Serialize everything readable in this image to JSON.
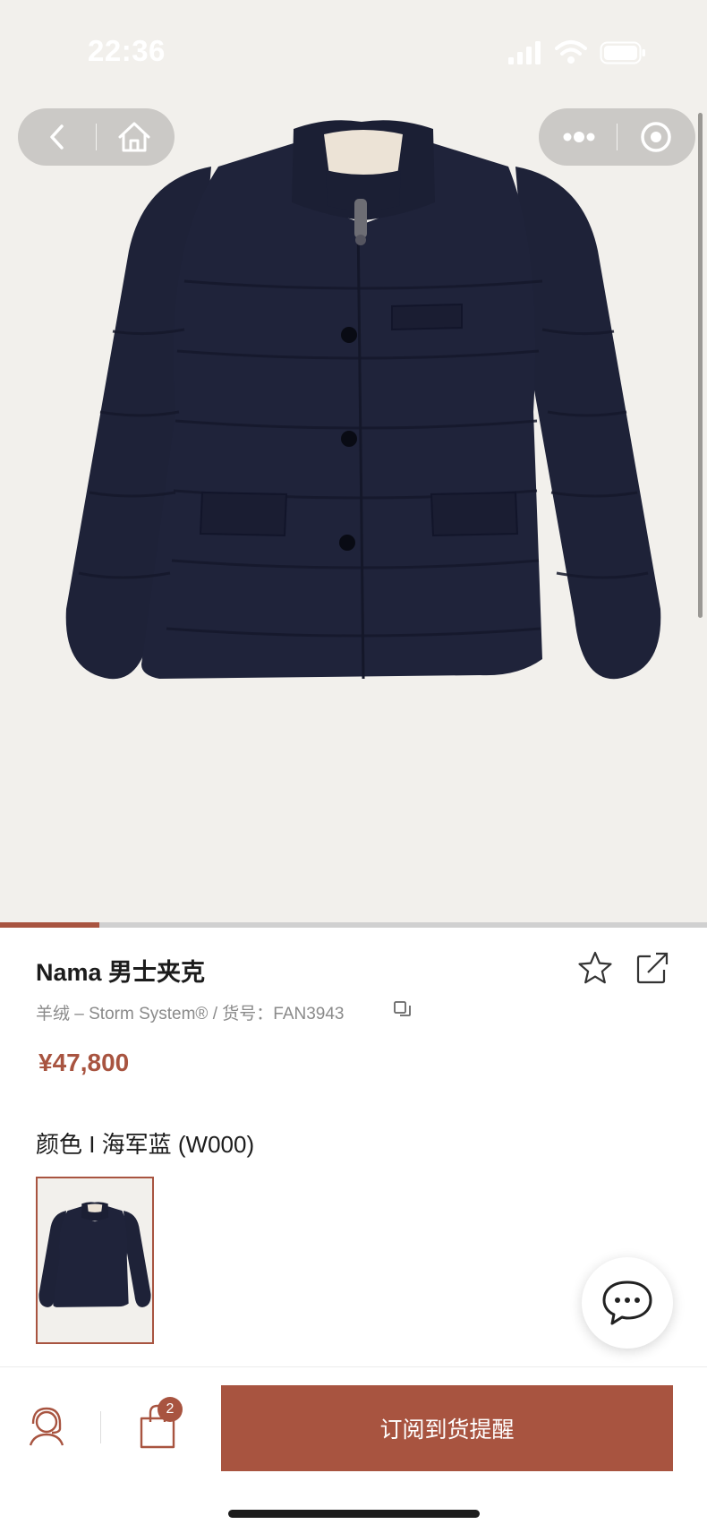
{
  "status_bar": {
    "time": "22:36",
    "icons": [
      "cellular-signal-icon",
      "wifi-icon",
      "battery-icon"
    ]
  },
  "nav": {
    "back_icon": "chevron-left-icon",
    "home_icon": "home-icon",
    "more_icon": "more-dots-icon",
    "close_icon": "target-close-icon"
  },
  "gallery": {
    "image": "navy-down-jacket",
    "progress": 0.14
  },
  "product": {
    "title": "Nama 男士夹克",
    "meta": "羊绒 – Storm System® / 货号：FAN3943",
    "price": "¥47,800",
    "color_line": "颜色 I 海军蓝 (W000)",
    "favorite_icon": "star-icon",
    "share_icon": "share-icon",
    "copy_icon": "copy-icon"
  },
  "swatches": [
    {
      "image": "navy-down-jacket",
      "selected": true
    }
  ],
  "chat": {
    "icon": "chat-bubble-icon"
  },
  "bottom_bar": {
    "service_icon": "customer-service-icon",
    "cart_icon": "shopping-bag-icon",
    "cart_count": "2",
    "subscribe_label": "订阅到货提醒"
  },
  "colors": {
    "accent": "#a85440",
    "hero_background": "#f2f0ec",
    "jacket": "#1e2238",
    "nav_pill": "#cbc9c6"
  }
}
